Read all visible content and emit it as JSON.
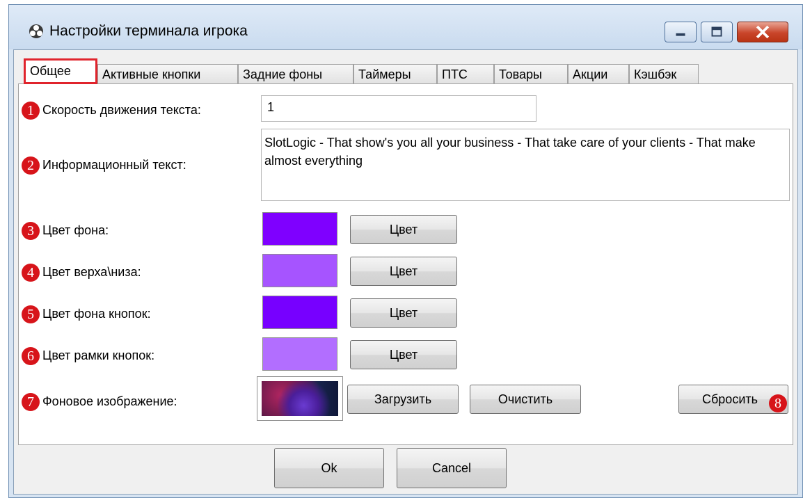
{
  "window": {
    "title": "Настройки терминала игрока",
    "icon": "app-icon",
    "controls": [
      "minimize-icon",
      "maximize-icon",
      "close-icon"
    ]
  },
  "tabs": [
    {
      "label": "Общее",
      "active": true
    },
    {
      "label": "Активные кнопки",
      "active": false
    },
    {
      "label": "Задние фоны",
      "active": false
    },
    {
      "label": "Таймеры",
      "active": false
    },
    {
      "label": "ПТС",
      "active": false
    },
    {
      "label": "Товары",
      "active": false
    },
    {
      "label": "Акции",
      "active": false
    },
    {
      "label": "Кэшбэк",
      "active": false
    }
  ],
  "settings": {
    "speed": {
      "badge": "1",
      "label": "Скорость движения текста:",
      "value": "1"
    },
    "info": {
      "badge": "2",
      "label": "Информационный текст:",
      "value": "SlotLogic  - That show's you all your business - That take care of your clients - That make almost everything"
    },
    "bg_color": {
      "badge": "3",
      "label": "Цвет фона:",
      "color": "#7f00ff",
      "button": "Цвет"
    },
    "topbottom_color": {
      "badge": "4",
      "label": "Цвет верха\\низа:",
      "color": "#a654ff",
      "button": "Цвет"
    },
    "button_bg_color": {
      "badge": "5",
      "label": "Цвет фона кнопок:",
      "color": "#7700ff",
      "button": "Цвет"
    },
    "button_border_color": {
      "badge": "6",
      "label": "Цвет рамки кнопок:",
      "color": "#b26eff",
      "button": "Цвет"
    },
    "bg_image": {
      "badge": "7",
      "label": "Фоновое изображение:",
      "load_button": "Загрузить",
      "clear_button": "Очистить"
    },
    "reset": {
      "badge": "8",
      "button": "Сбросить"
    }
  },
  "footer": {
    "ok": "Ok",
    "cancel": "Cancel"
  },
  "accent": "#e0242c"
}
